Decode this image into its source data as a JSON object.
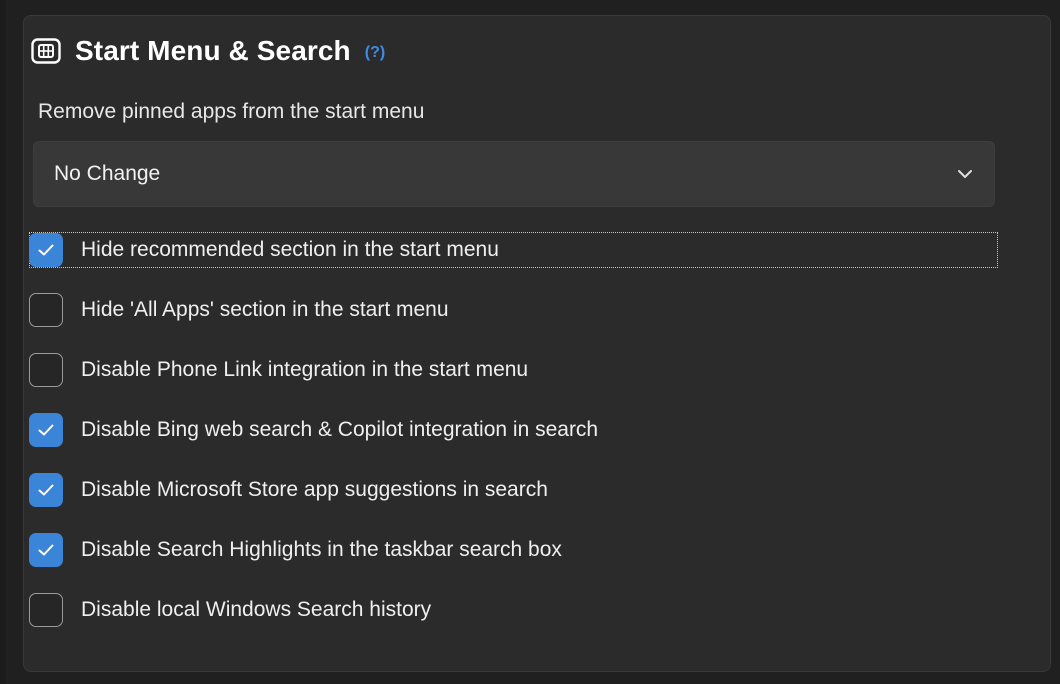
{
  "section": {
    "title": "Start Menu & Search",
    "help_label": "(?)",
    "icon": "start-menu-icon"
  },
  "pinned_apps": {
    "label": "Remove pinned apps from the start menu",
    "selected": "No Change"
  },
  "options": [
    {
      "label": "Hide recommended section in the start menu",
      "checked": true
    },
    {
      "label": "Hide 'All Apps' section in the start menu",
      "checked": false
    },
    {
      "label": "Disable Phone Link integration in the start menu",
      "checked": false
    },
    {
      "label": "Disable Bing web search & Copilot integration in search",
      "checked": true
    },
    {
      "label": "Disable Microsoft Store app suggestions in search",
      "checked": true
    },
    {
      "label": "Disable Search Highlights in the taskbar search box",
      "checked": true
    },
    {
      "label": "Disable local Windows Search history",
      "checked": false
    }
  ],
  "colors": {
    "accent": "#3a85d8",
    "help": "#3f8bea",
    "card": "#2b2b2b",
    "background": "#202020"
  }
}
